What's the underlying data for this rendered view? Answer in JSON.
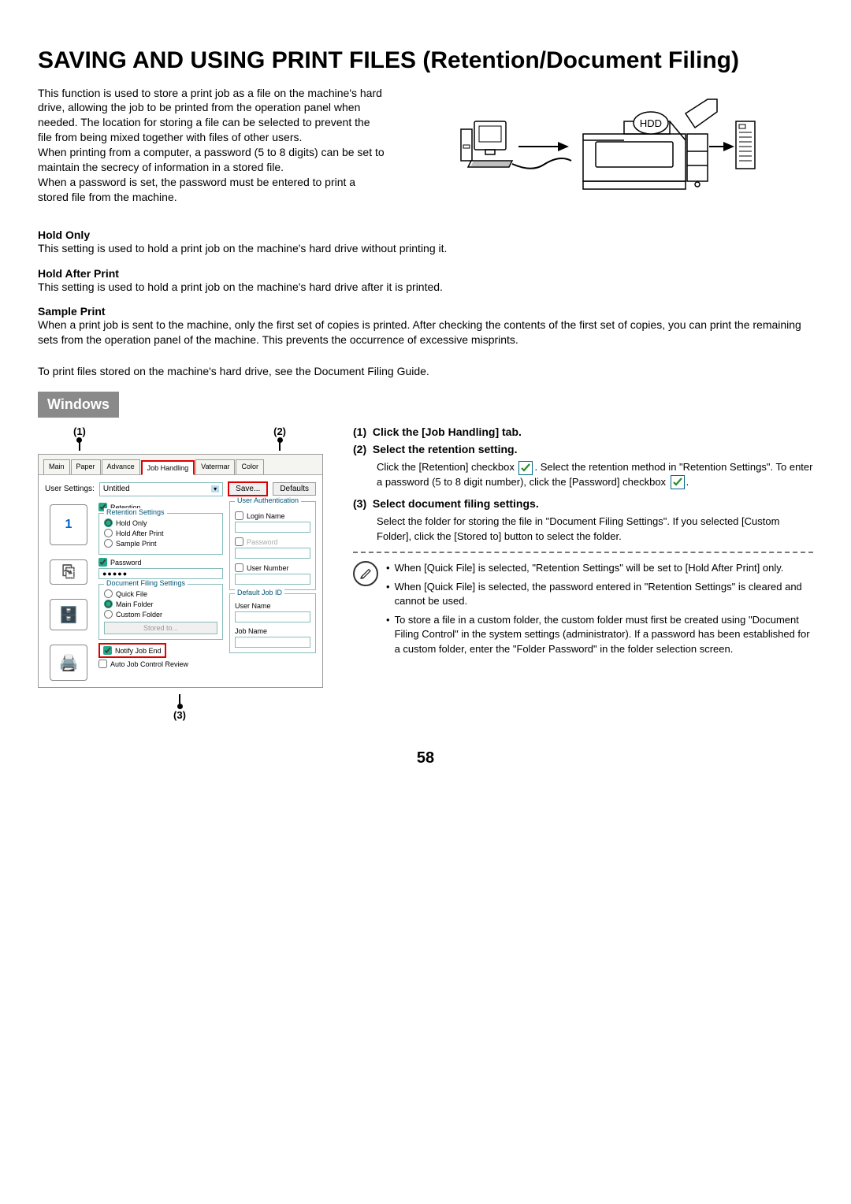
{
  "title": "SAVING AND USING PRINT FILES (Retention/Document Filing)",
  "intro": "This function is used to store a print job as a file on the machine's hard drive, allowing the job to be printed from the operation panel when needed. The location for storing a file can be selected to prevent the file from being mixed together with files of other users.\nWhen printing from a computer, a password (5 to 8 digits) can be set to maintain the secrecy of information in a stored file.\nWhen a password is set, the password must be entered to print a stored file from the machine.",
  "diagram_label": "HDD",
  "defs": [
    {
      "title": "Hold Only",
      "body": "This setting is used to hold a print job on the machine's hard drive without printing it."
    },
    {
      "title": "Hold After Print",
      "body": "This setting is used to hold a print job on the machine's hard drive after it is printed."
    },
    {
      "title": "Sample Print",
      "body": "When a print job is sent to the machine, only the first set of copies is printed. After checking the contents of the first set of copies, you can print the remaining sets from the operation panel of the machine. This prevents the occurrence of excessive misprints."
    }
  ],
  "crossref": "To print files stored on the machine's hard drive, see the Document Filing Guide.",
  "os_badge": "Windows",
  "callouts": {
    "one": "(1)",
    "two": "(2)",
    "three": "(3)"
  },
  "dialog": {
    "tabs": [
      "Main",
      "Paper",
      "Advance",
      "Job Handling",
      "Vatermar",
      "Color"
    ],
    "active_tab": 3,
    "user_settings_label": "User Settings:",
    "user_settings_value": "Untitled",
    "save_btn": "Save...",
    "defaults_btn": "Defaults",
    "retention_chk": "Retention",
    "retention_settings_legend": "Retention Settings",
    "hold_only": "Hold Only",
    "hold_after": "Hold After Print",
    "sample_print": "Sample Print",
    "password_chk": "Password",
    "password_value": "●●●●●",
    "doc_filing_legend": "Document Filing Settings",
    "quick_file": "Quick File",
    "main_folder": "Main Folder",
    "custom_folder": "Custom Folder",
    "stored_to": "Stored to...",
    "notify_chk": "Notify Job End",
    "auto_review_chk": "Auto Job Control Review",
    "user_auth_legend": "User Authentication",
    "login_name": "Login Name",
    "password_label": "Password",
    "user_number": "User Number",
    "default_job_legend": "Default Job ID",
    "user_name": "User Name",
    "job_name": "Job Name",
    "icon_one": "1"
  },
  "steps": [
    {
      "num": "(1)",
      "title": "Click the [Job Handling] tab."
    },
    {
      "num": "(2)",
      "title": "Select the retention setting.",
      "body_pre": "Click the [Retention] checkbox ",
      "body_mid": ". Select the retention method in \"Retention Settings\". To enter a password (5 to 8 digit number), click the [Password] checkbox ",
      "body_post": "."
    },
    {
      "num": "(3)",
      "title": "Select document filing settings.",
      "body": "Select the folder for storing the file in \"Document Filing Settings\". If you selected [Custom Folder], click the [Stored to] button to select the folder."
    }
  ],
  "notes": [
    "When [Quick File] is selected, \"Retention Settings\" will be set to [Hold After Print] only.",
    "When [Quick File] is selected, the password entered in \"Retention Settings\" is cleared and cannot be used.",
    "To store a file in a custom folder, the custom folder must first be created using \"Document Filing Control\" in the system settings (administrator). If a password has been established for a custom folder, enter the \"Folder Password\" in the folder selection screen."
  ],
  "page_number": "58"
}
